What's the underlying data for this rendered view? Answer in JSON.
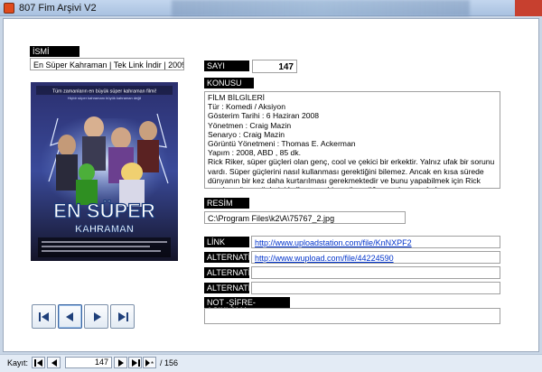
{
  "window": {
    "title": "807 Fim Arşivi V2"
  },
  "form": {
    "isim_label": "İSMİ",
    "isim_value": "En Süper Kahraman | Tek Link İndir | 2009 |",
    "sayi_label": "SAYI",
    "sayi_value": "147",
    "konusu_label": "KONUSU",
    "konusu_lines": [
      "FİLM BİLGİLERİ",
      "Tür : Komedi / Aksiyon",
      "Gösterim Tarihi : 6 Haziran 2008",
      "Yönetmen : Craig Mazin",
      "Senaryo : Craig Mazin",
      "Görüntü Yönetmeni : Thomas E. Ackerman",
      "Yapım : 2008, ABD , 85 dk.",
      "Rick Riker, süper güçleri olan genç, cool ve çekici bir erkektir. Yalnız ufak bir sorunu vardı. Süper güçlerini nasıl kullanması gerektiğini bilemez. Ancak en kısa sürede dünyanın bir kez daha kurtarılması gerekmektedir ve bunu yapabilmek için Rick yaralan süper güçlerini kullanmayı bir an önce öğrenmek zorundadır."
    ],
    "resim_label": "RESİM",
    "resim_value": "C:\\Program Files\\k2\\A\\75767_2.jpg",
    "link_label": "LİNK",
    "link_value": "http://www.uploadstation.com/file/KnNXPF2",
    "alt1_label": "ALTERNATİF",
    "alt1_value": "http://www.wupload.com/file/44224590",
    "alt2_label": "ALTERNATİF",
    "alt2_value": "",
    "alt3_label": "ALTERNATİF",
    "alt3_value": "",
    "not_label": "NOT -ŞİFRE-AÇIKLAMA",
    "not_value": ""
  },
  "poster": {
    "tagline": "Tüm zamanların en büyük süper kahraman filmi!",
    "sub": "Hiçbir süper kahramanı büyük kahraman değil",
    "title_line1": "EN SÜPER",
    "title_line2": "KAHRAMAN"
  },
  "status": {
    "kayit_label": "Kayıt:",
    "current": "147",
    "separator": "/",
    "total": "156"
  },
  "colors": {
    "form_bg": "#ffffff",
    "label_bg": "#000000",
    "link": "#0033cc",
    "window_bg": "#c9d6e6"
  },
  "icons": [
    "first-record-icon",
    "previous-record-icon",
    "next-record-icon",
    "last-record-icon",
    "new-record-icon"
  ]
}
